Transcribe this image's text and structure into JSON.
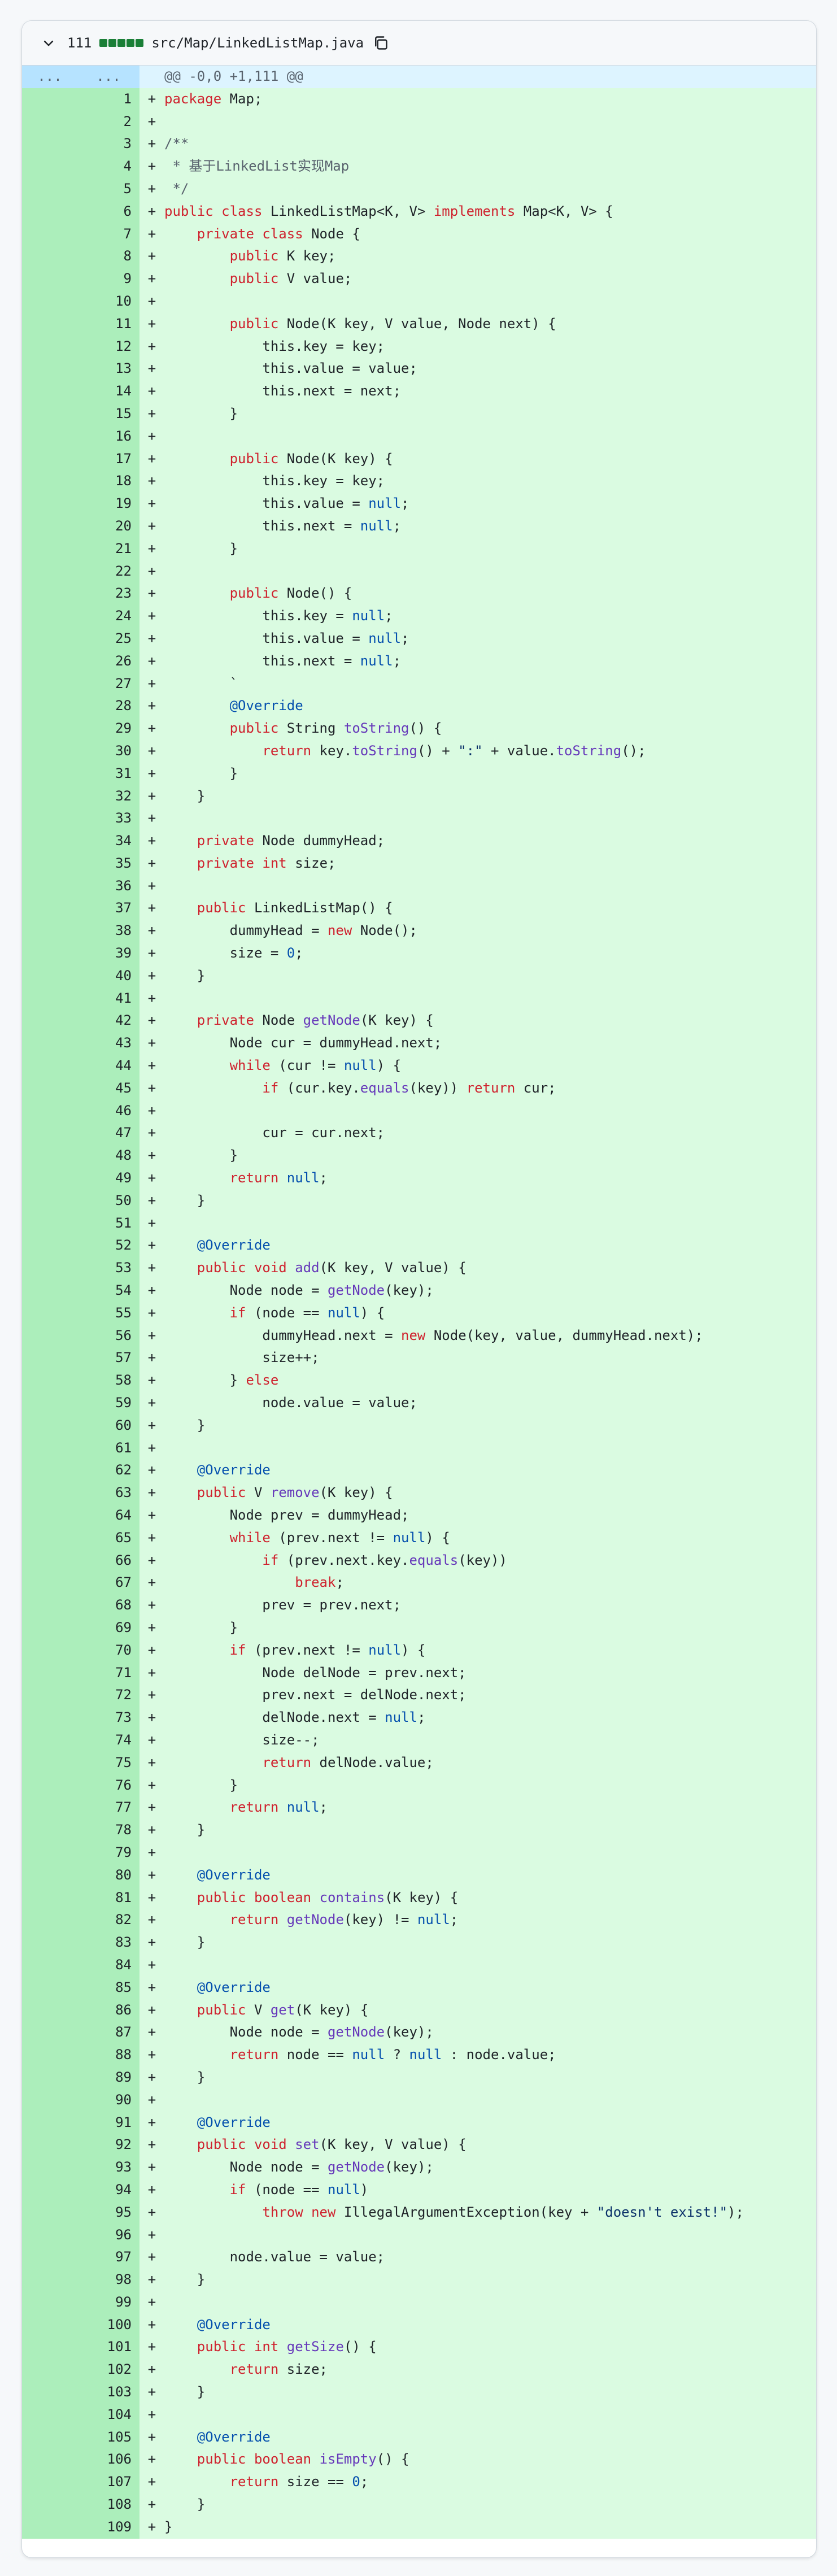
{
  "file": {
    "change_count": "111",
    "path": "src/Map/LinkedListMap.java",
    "diffstat_blocks": 5,
    "icons": {
      "expand": "chevron-down-icon",
      "copy": "copy-icon"
    }
  },
  "hunk": {
    "left": "...",
    "right": "...",
    "text": "@@ -0,0 +1,111 @@"
  },
  "colors": {
    "added_line": "#dafbe1",
    "added_gutter": "#aceebb",
    "hunk_bg": "#ddf4ff",
    "hunk_gutter": "#b6e3ff",
    "keyword": "#cf222e",
    "builtin": "#0550ae",
    "method": "#6639ba",
    "string": "#0a3069"
  },
  "lines": [
    "package Map;",
    "",
    "/**",
    " * 基于LinkedList实现Map",
    " */",
    "public class LinkedListMap<K, V> implements Map<K, V> {",
    "    private class Node {",
    "        public K key;",
    "        public V value;",
    "",
    "        public Node(K key, V value, Node next) {",
    "            this.key = key;",
    "            this.value = value;",
    "            this.next = next;",
    "        }",
    "",
    "        public Node(K key) {",
    "            this.key = key;",
    "            this.value = null;",
    "            this.next = null;",
    "        }",
    "",
    "        public Node() {",
    "            this.key = null;",
    "            this.value = null;",
    "            this.next = null;",
    "        `",
    "        @Override",
    "        public String toString() {",
    "            return key.toString() + \":\" + value.toString();",
    "        }",
    "    }",
    "",
    "    private Node dummyHead;",
    "    private int size;",
    "",
    "    public LinkedListMap() {",
    "        dummyHead = new Node();",
    "        size = 0;",
    "    }",
    "",
    "    private Node getNode(K key) {",
    "        Node cur = dummyHead.next;",
    "        while (cur != null) {",
    "            if (cur.key.equals(key)) return cur;",
    "",
    "            cur = cur.next;",
    "        }",
    "        return null;",
    "    }",
    "",
    "    @Override",
    "    public void add(K key, V value) {",
    "        Node node = getNode(key);",
    "        if (node == null) {",
    "            dummyHead.next = new Node(key, value, dummyHead.next);",
    "            size++;",
    "        } else",
    "            node.value = value;",
    "    }",
    "",
    "    @Override",
    "    public V remove(K key) {",
    "        Node prev = dummyHead;",
    "        while (prev.next != null) {",
    "            if (prev.next.key.equals(key))",
    "                break;",
    "            prev = prev.next;",
    "        }",
    "        if (prev.next != null) {",
    "            Node delNode = prev.next;",
    "            prev.next = delNode.next;",
    "            delNode.next = null;",
    "            size--;",
    "            return delNode.value;",
    "        }",
    "        return null;",
    "    }",
    "",
    "    @Override",
    "    public boolean contains(K key) {",
    "        return getNode(key) != null;",
    "    }",
    "",
    "    @Override",
    "    public V get(K key) {",
    "        Node node = getNode(key);",
    "        return node == null ? null : node.value;",
    "    }",
    "",
    "    @Override",
    "    public void set(K key, V value) {",
    "        Node node = getNode(key);",
    "        if (node == null)",
    "            throw new IllegalArgumentException(key + \"doesn't exist!\");",
    "",
    "        node.value = value;",
    "    }",
    "",
    "    @Override",
    "    public int getSize() {",
    "        return size;",
    "    }",
    "",
    "    @Override",
    "    public boolean isEmpty() {",
    "        return size == 0;",
    "    }",
    "}"
  ]
}
